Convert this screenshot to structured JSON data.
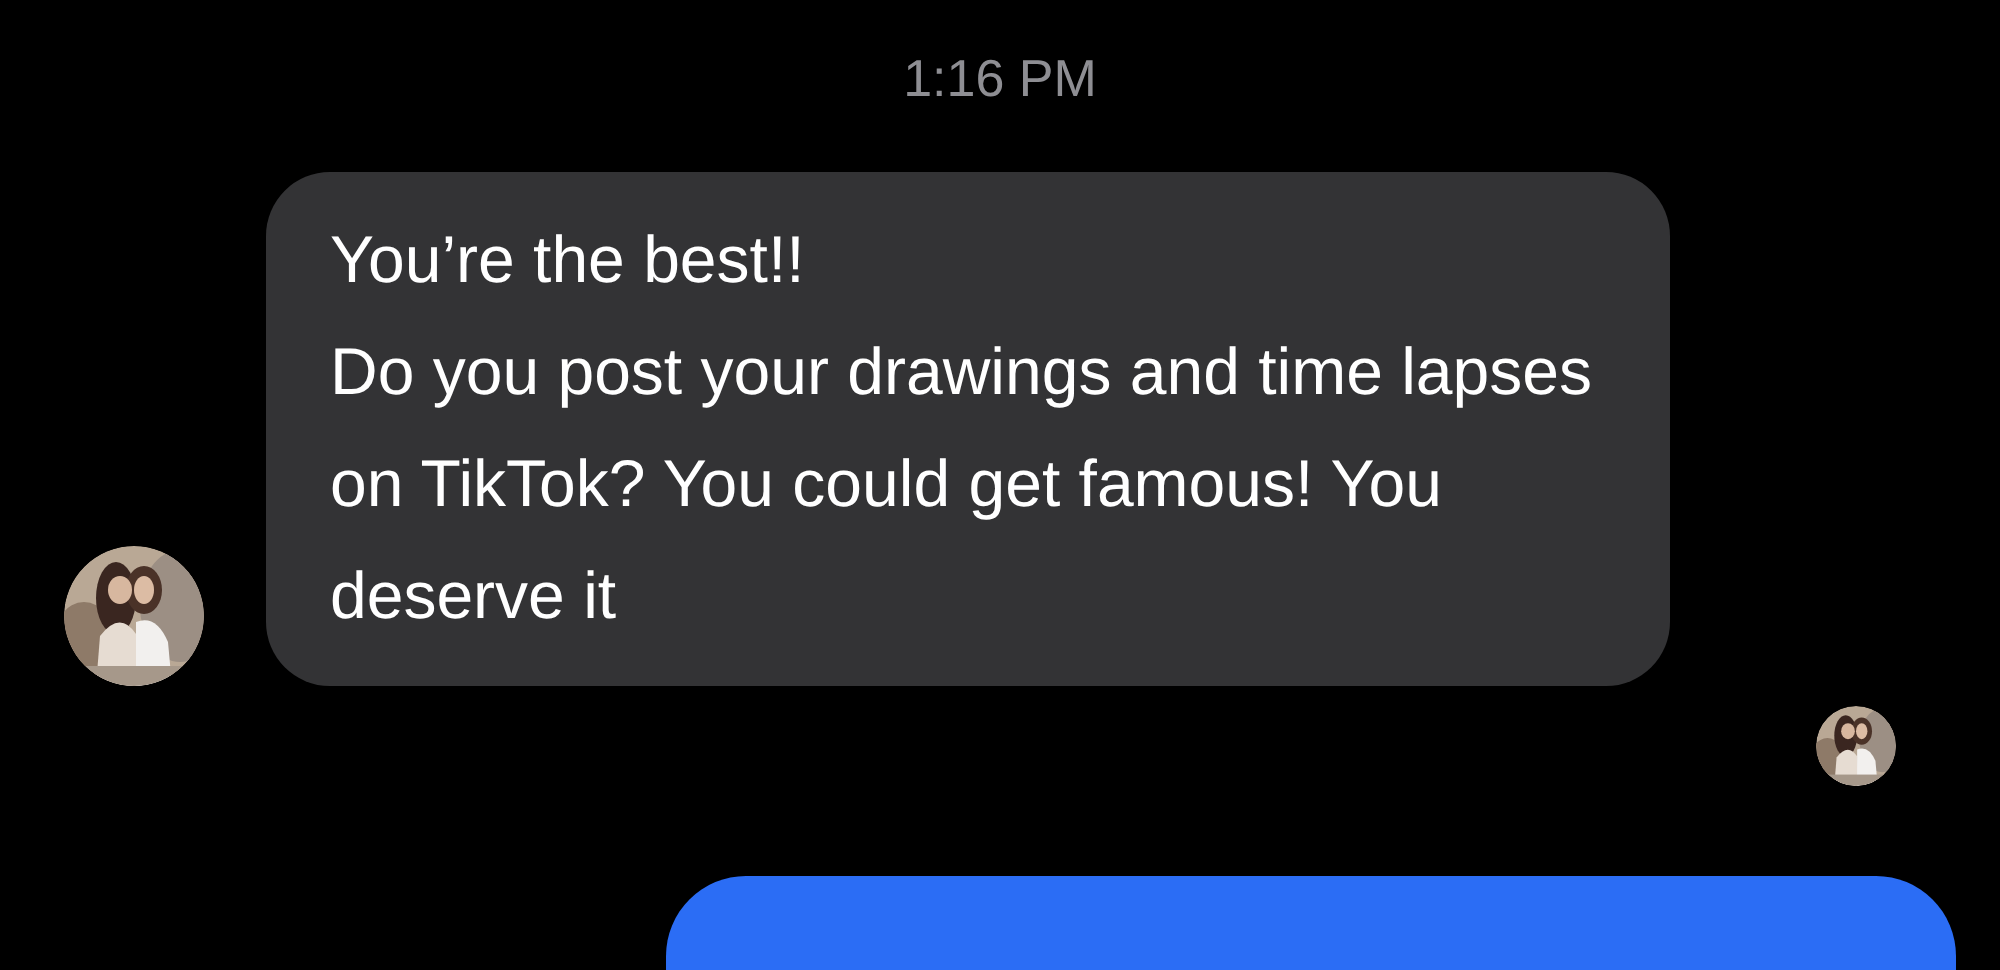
{
  "timestamp": "1:16 PM",
  "messages": [
    {
      "kind": "received",
      "text": "You’re the best!!\nDo you post your drawings and time lapses on TikTok? You could get famous! You deserve it"
    },
    {
      "kind": "read_receipt"
    },
    {
      "kind": "sent"
    }
  ]
}
